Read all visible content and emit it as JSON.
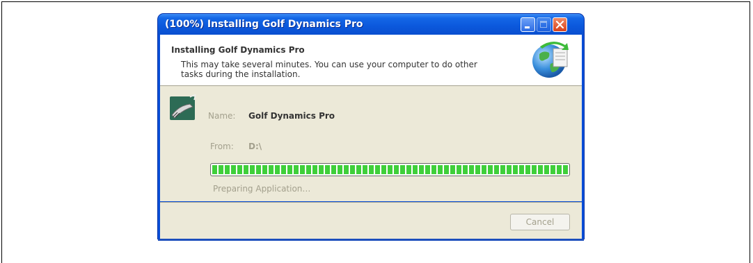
{
  "window": {
    "title": "(100%) Installing Golf Dynamics Pro"
  },
  "header": {
    "title": "Installing Golf Dynamics Pro",
    "description": "This may take several minutes. You can use your computer to do other tasks during the installation.",
    "icon": "installer-globe-icon"
  },
  "app": {
    "icon": "golf-club-icon",
    "name_label": "Name:",
    "name_value": "Golf Dynamics Pro",
    "from_label": "From:",
    "from_value": "D:\\"
  },
  "progress": {
    "percent": 100,
    "status": "Preparing Application…",
    "color": "#3fcf3a"
  },
  "footer": {
    "cancel_label": "Cancel",
    "cancel_enabled": false
  }
}
